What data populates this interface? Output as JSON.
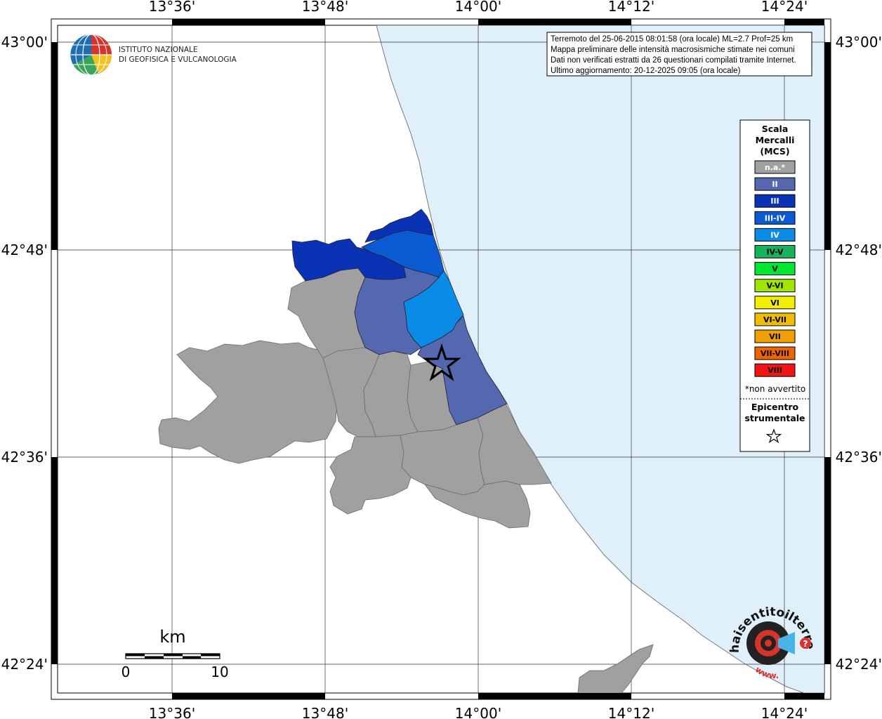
{
  "logo": {
    "line1": "ISTITUTO NAZIONALE",
    "line2": "DI GEOFISICA E VULCANOLOGIA"
  },
  "info": {
    "line1": "Terremoto del 25-06-2015 08:01:58 (ora locale) ML=2.7 Prof=25 km",
    "line2": "Mappa preliminare delle intensità macrosismiche stimate nei comuni",
    "line3": "Dati non verificati estratti da 26 questionari compilati tramite Internet.",
    "line4": "Ultimo aggiornamento: 20-12-2025 09:05 (ora locale)"
  },
  "longitude_labels": [
    "13°36'",
    "13°48'",
    "14°00'",
    "14°12'",
    "14°24'"
  ],
  "latitude_labels": [
    "43°00'",
    "42°48'",
    "42°36'",
    "42°24'"
  ],
  "legend": {
    "title1": "Scala",
    "title2": "Mercalli",
    "title3": "(MCS)",
    "items": [
      {
        "label": "n.a.*",
        "color": "#a0a0a0",
        "text_color": "#ffffff"
      },
      {
        "label": "II",
        "color": "#5468b0",
        "text_color": "#ffffff"
      },
      {
        "label": "III",
        "color": "#0a32b4",
        "text_color": "#ffffff"
      },
      {
        "label": "III-IV",
        "color": "#0a5ad2",
        "text_color": "#ffffff"
      },
      {
        "label": "IV",
        "color": "#0a8ce6",
        "text_color": "#ffffff"
      },
      {
        "label": "IV-V",
        "color": "#16b45a",
        "text_color": "#000000"
      },
      {
        "label": "V",
        "color": "#00e632",
        "text_color": "#000000"
      },
      {
        "label": "V-VI",
        "color": "#a0e600",
        "text_color": "#000000"
      },
      {
        "label": "VI",
        "color": "#f0f000",
        "text_color": "#000000"
      },
      {
        "label": "VI-VII",
        "color": "#f0be00",
        "text_color": "#000000"
      },
      {
        "label": "VII",
        "color": "#f0a000",
        "text_color": "#000000"
      },
      {
        "label": "VII-VIII",
        "color": "#f06400",
        "text_color": "#000000"
      },
      {
        "label": "VIII",
        "color": "#f01414",
        "text_color": "#000000"
      }
    ],
    "note": "*non avvertito",
    "epicenter1": "Epicentro",
    "epicenter2": "strumentale"
  },
  "scale_bar": {
    "unit": "km",
    "labels": [
      "0",
      "10"
    ]
  },
  "brand": {
    "text": "haisentitoilterremoto.it",
    "url": "www."
  },
  "colors": {
    "sea": "#dff0fb",
    "land": "#ffffff",
    "coast": "#777777",
    "na": "#a0a0a0",
    "II": "#5468b0",
    "III": "#0a32b4",
    "III-IV": "#0a5ad2",
    "IV": "#0a8ce6"
  }
}
